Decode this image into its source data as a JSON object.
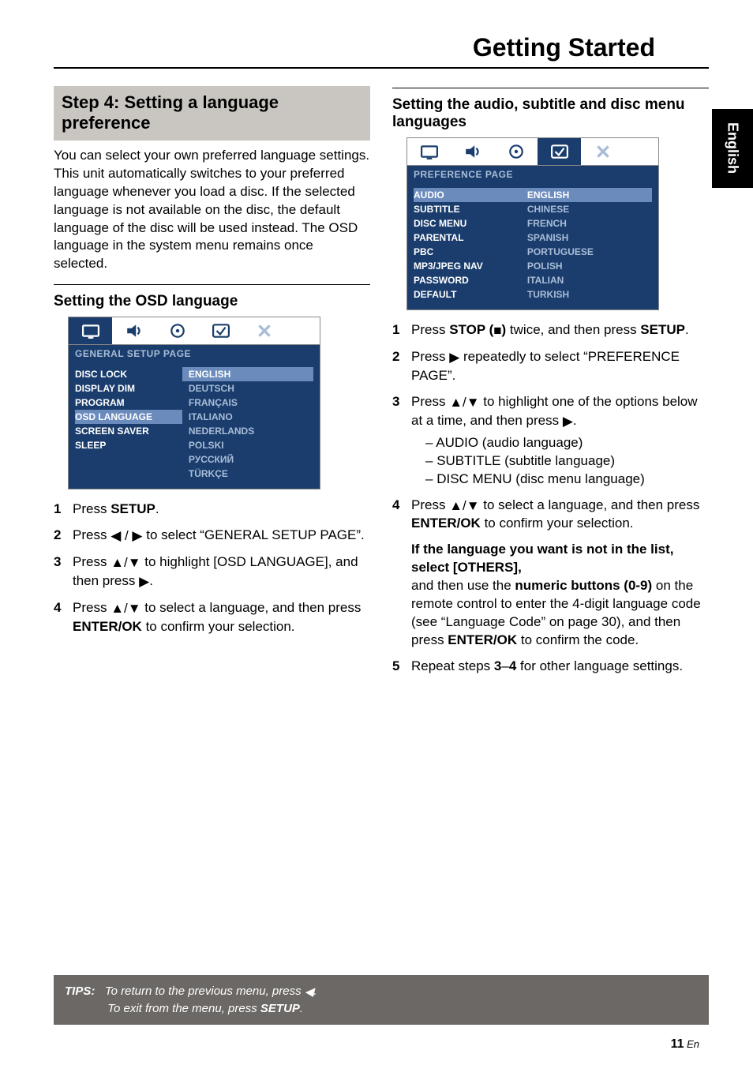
{
  "header": {
    "title": "Getting Started"
  },
  "side_tab": "English",
  "left": {
    "grey_heading": "Step 4: Setting a language preference",
    "paragraph": "You can select your own preferred language settings. This unit automatically switches to your preferred language whenever you load a disc. If the selected language is not available on the disc, the default language of the disc will be used instead. The OSD language in the system menu remains once selected.",
    "sub_heading": "Setting the OSD language",
    "osd": {
      "page_label": "GENERAL SETUP PAGE",
      "rows": [
        {
          "l": "DISC LOCK",
          "r": "ENGLISH",
          "l_hl": false,
          "r_sel": true
        },
        {
          "l": "DISPLAY DIM",
          "r": "DEUTSCH"
        },
        {
          "l": "PROGRAM",
          "r": "FRANÇAIS"
        },
        {
          "l": "OSD LANGUAGE",
          "r": "ITALIANO",
          "l_hl": true
        },
        {
          "l": "SCREEN SAVER",
          "r": "NEDERLANDS"
        },
        {
          "l": "SLEEP",
          "r": "POLSKI"
        },
        {
          "l": "",
          "r": "РУССКИЙ"
        },
        {
          "l": "",
          "r": "TÜRKÇE"
        }
      ]
    },
    "steps": {
      "s1_a": "Press ",
      "s1_b": "SETUP",
      "s1_c": ".",
      "s2_a": "Press ",
      "s2_glyph": "◀ / ▶",
      "s2_b": " to select “GENERAL SETUP PAGE”.",
      "s3_a": "Press ",
      "s3_glyph": "▲/▼",
      "s3_b": " to highlight [OSD LANGUAGE], and then press ",
      "s3_glyph2": "▶",
      "s3_c": ".",
      "s4_a": "Press ",
      "s4_glyph": "▲/▼",
      "s4_b": " to select a language, and then press ",
      "s4_bold": "ENTER/OK",
      "s4_c": " to confirm your selection."
    }
  },
  "right": {
    "sub_heading": "Setting the audio, subtitle and disc menu languages",
    "osd": {
      "page_label": "PREFERENCE PAGE",
      "rows": [
        {
          "l": "AUDIO",
          "r": "ENGLISH",
          "l_hl": true,
          "r_sel": true
        },
        {
          "l": "SUBTITLE",
          "r": "CHINESE"
        },
        {
          "l": "DISC MENU",
          "r": "FRENCH"
        },
        {
          "l": "PARENTAL",
          "r": "SPANISH"
        },
        {
          "l": "PBC",
          "r": "PORTUGUESE"
        },
        {
          "l": "MP3/JPEG NAV",
          "r": "POLISH"
        },
        {
          "l": "PASSWORD",
          "r": "ITALIAN"
        },
        {
          "l": "DEFAULT",
          "r": "TURKISH"
        }
      ]
    },
    "steps": {
      "s1_a": "Press ",
      "s1_bold": "STOP (",
      "s1_glyph": "■",
      "s1_bold2": ")",
      "s1_b": " twice, and then press ",
      "s1_bold3": "SETUP",
      "s1_c": ".",
      "s2_a": "Press ",
      "s2_glyph": "▶",
      "s2_b": " repeatedly to select “PREFERENCE PAGE”.",
      "s3_a": "Press ",
      "s3_glyph": "▲/▼",
      "s3_b": " to highlight one of the options below at a time, and then press ",
      "s3_glyph2": "▶",
      "s3_c": ".",
      "s3_items": [
        "AUDIO (audio language)",
        "SUBTITLE (subtitle language)",
        "DISC MENU (disc menu language)"
      ],
      "s4_a": "Press ",
      "s4_glyph": "▲/▼",
      "s4_b": " to select a language, and then press ",
      "s4_bold": "ENTER/OK",
      "s4_c": " to confirm your selection.",
      "note_bold": "If the language you want is not in the list, select [OTHERS],",
      "note_body_a": "and then use the ",
      "note_body_bold": "numeric buttons (0-9)",
      "note_body_b": " on the remote control to enter the 4-digit language code (see “Language Code” on page 30), and then press ",
      "note_body_bold2": "ENTER/OK",
      "note_body_c": " to confirm the code.",
      "s5_a": "Repeat steps ",
      "s5_bold": "3",
      "s5_dash": "–",
      "s5_bold2": "4",
      "s5_b": " for other language settings."
    }
  },
  "tips": {
    "label": "TIPS:",
    "line1_a": "To return to the previous menu, press ",
    "line1_glyph": "◀",
    "line1_b": ".",
    "line2_a": "To exit from the menu, press ",
    "line2_bold": "SETUP",
    "line2_b": "."
  },
  "page_number": {
    "num": "11",
    "suffix": " En"
  },
  "icons": {
    "tv": "tv-icon",
    "speaker": "speaker-icon",
    "disc": "disc-icon",
    "check": "check-icon",
    "x": "x-icon"
  }
}
